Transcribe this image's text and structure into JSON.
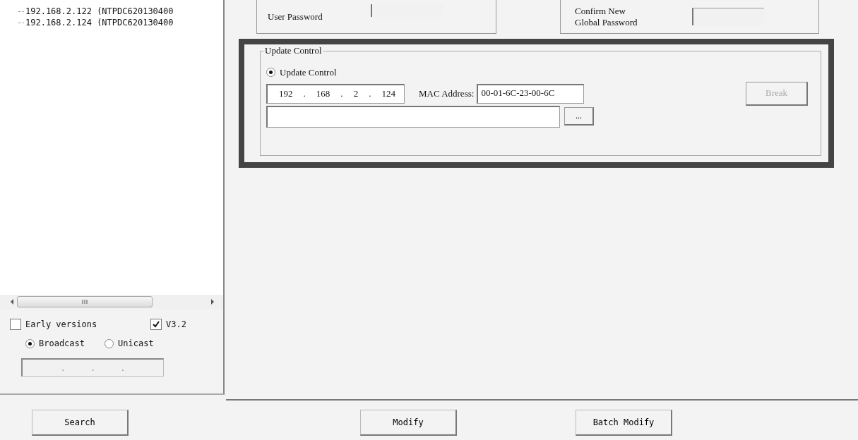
{
  "tree": {
    "items": [
      {
        "label": "192.168.2.122 (NTPDC620130400"
      },
      {
        "label": "192.168.2.124 (NTPDC620130400"
      }
    ]
  },
  "options": {
    "early_versions": {
      "label": "Early versions",
      "checked": false
    },
    "v32": {
      "label": "V3.2",
      "checked": true
    },
    "modes": [
      {
        "label": "Broadcast",
        "selected": true
      },
      {
        "label": "Unicast",
        "selected": false
      }
    ],
    "unicast_ip": {
      "separator": ".",
      "disabled": true
    }
  },
  "passwords": {
    "user_password": {
      "label": "User Password"
    },
    "confirm_global": {
      "label_lines": [
        "Confirm New",
        "Global Password"
      ]
    }
  },
  "update_control": {
    "legend": "Update Control",
    "radio": {
      "label": "Update Control",
      "selected": true
    },
    "ip": {
      "octets": [
        "192",
        "168",
        "2",
        "124"
      ],
      "separator": "."
    },
    "mac_label": "MAC Address:",
    "mac_value": "00-01-6C-23-00-6C",
    "browse_button": "...",
    "break_button": {
      "label": "Break",
      "disabled": true
    }
  },
  "buttons": {
    "search": "Search",
    "modify": "Modify",
    "batch_modify": "Batch Modify"
  }
}
